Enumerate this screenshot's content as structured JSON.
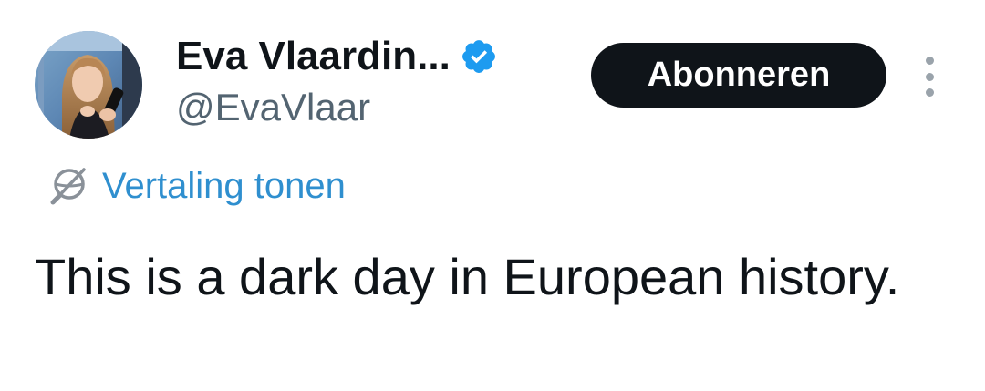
{
  "author": {
    "display_name": "Eva Vlaardin...",
    "handle": "@EvaVlaar",
    "verified": true,
    "avatar_icon": "profile-photo"
  },
  "actions": {
    "subscribe_label": "Abonneren",
    "more_icon": "vertical-ellipsis-icon"
  },
  "translation": {
    "label": "Vertaling tonen",
    "icon": "translate-globe-icon"
  },
  "tweet": {
    "text": "This is a dark day in European history."
  },
  "colors": {
    "text_primary": "#0f1419",
    "text_secondary": "#536471",
    "link": "#2f8fcf",
    "button_bg": "#0f1419",
    "button_text": "#ffffff",
    "verified_badge": "#1d9bf0"
  }
}
